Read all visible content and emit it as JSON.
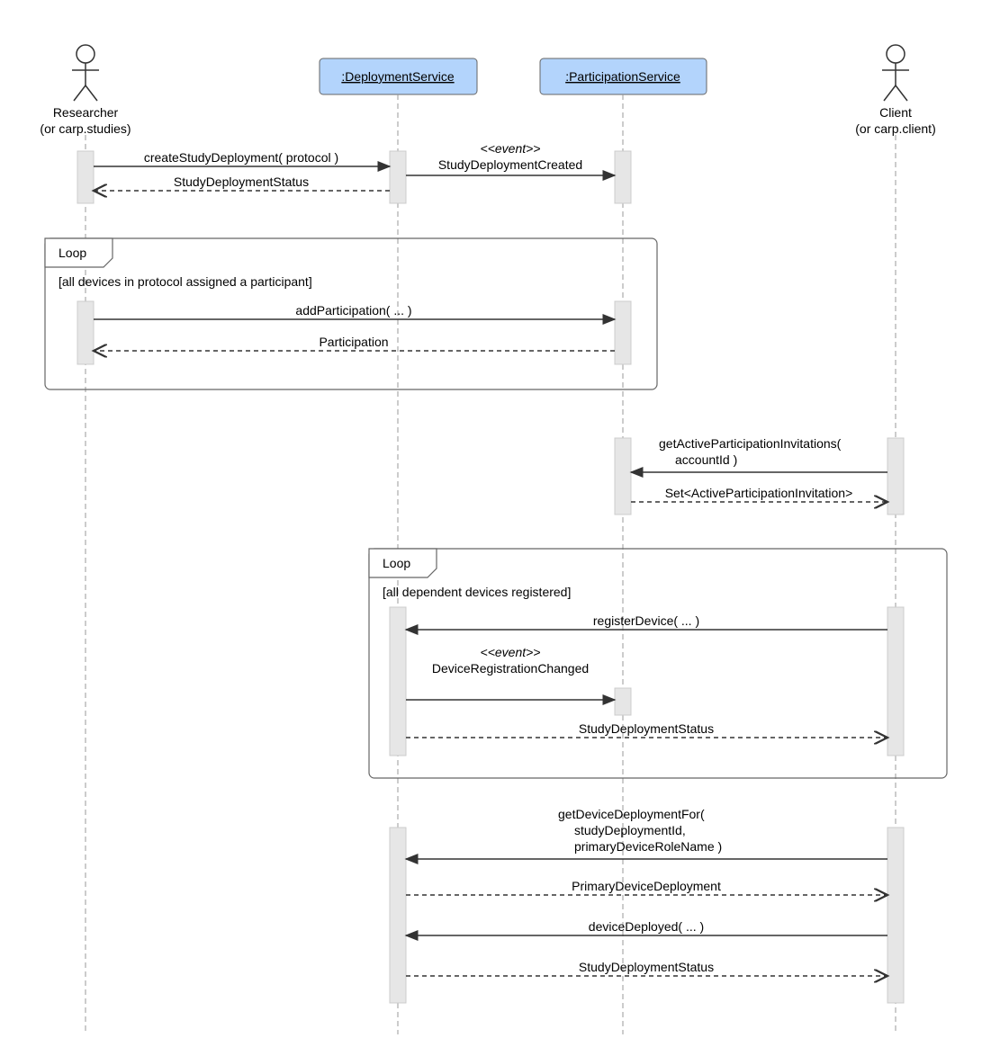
{
  "lifelines": {
    "researcher": {
      "name": "Researcher",
      "sub": "(or carp.studies)"
    },
    "deployment": {
      "name": ":DeploymentService"
    },
    "participation": {
      "name": ":ParticipationService"
    },
    "client": {
      "name": "Client",
      "sub": "(or carp.client)"
    }
  },
  "messages": {
    "m1": "createStudyDeployment( protocol )",
    "m2_event": "<<event>>",
    "m2": "StudyDeploymentCreated",
    "m3": "StudyDeploymentStatus",
    "loop1_label": "Loop",
    "loop1_guard": "[all devices in protocol assigned a participant]",
    "m4": "addParticipation( ... )",
    "m5": "Participation",
    "m6a": "getActiveParticipationInvitations(",
    "m6b": "accountId )",
    "m7": "Set<ActiveParticipationInvitation>",
    "loop2_label": "Loop",
    "loop2_guard": "[all dependent devices registered]",
    "m8": "registerDevice( ... )",
    "m9_event": "<<event>>",
    "m9": "DeviceRegistrationChanged",
    "m10": "StudyDeploymentStatus",
    "m11a": "getDeviceDeploymentFor(",
    "m11b": "studyDeploymentId,",
    "m11c": "primaryDeviceRoleName )",
    "m12": "PrimaryDeviceDeployment",
    "m13": "deviceDeployed( ... )",
    "m14": "StudyDeploymentStatus"
  }
}
